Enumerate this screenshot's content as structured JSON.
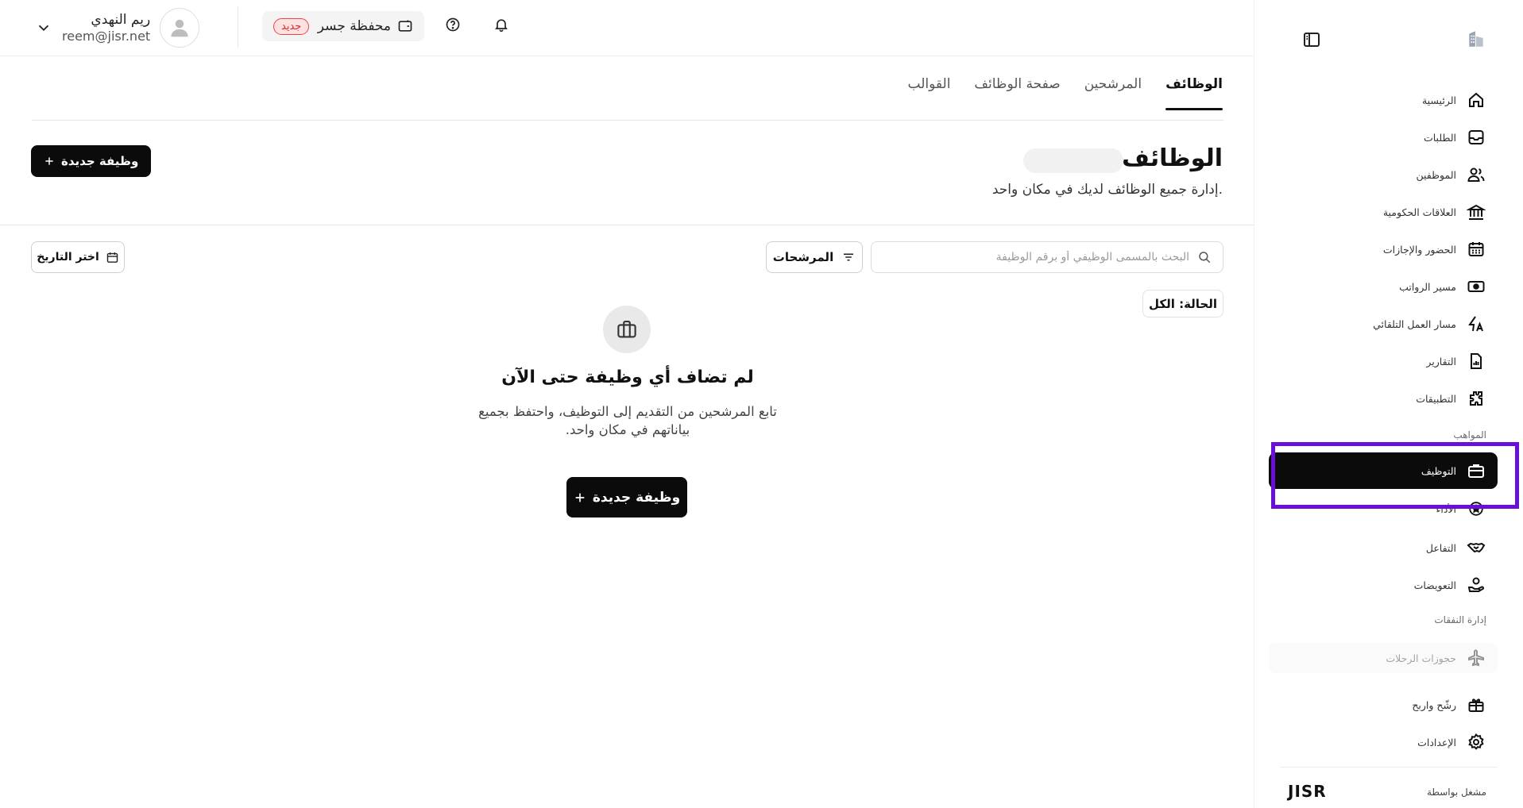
{
  "header": {
    "user_name": "ريم النهدي",
    "user_email": "reem@jisr.net",
    "wallet_label": "محفظة جسر",
    "wallet_badge": "جديد"
  },
  "tabs": [
    {
      "label": "الوظائف",
      "active": true
    },
    {
      "label": "المرشحين",
      "active": false
    },
    {
      "label": "صفحة الوظائف",
      "active": false
    },
    {
      "label": "القوالب",
      "active": false
    }
  ],
  "page": {
    "title": "الوظائف",
    "subtitle": "إدارة جميع الوظائف لديك في مكان واحد.",
    "new_job_label": "وظيفة جديدة"
  },
  "filters": {
    "search_placeholder": "البحث بالمسمى الوظيفي أو برقم الوظيفة",
    "filters_label": "المرشحات",
    "date_label": "اختر التاريخ",
    "status_chip": "الحالة: الكل"
  },
  "empty_state": {
    "title": "لم تضاف أي وظيفة حتى الآن",
    "description": "تابع المرشحين من التقديم إلى التوظيف، واحتفظ بجميع بياناتهم في مكان واحد.",
    "button_label": "وظيفة جديدة"
  },
  "sidebar": {
    "items": [
      {
        "label": "الرئيسية",
        "icon": "home-icon"
      },
      {
        "label": "الطلبات",
        "icon": "inbox-icon"
      },
      {
        "label": "الموظفين",
        "icon": "users-icon"
      },
      {
        "label": "العلاقات الحكومية",
        "icon": "bank-icon"
      },
      {
        "label": "الحضور والإجازات",
        "icon": "calendar-icon"
      },
      {
        "label": "مسير الرواتب",
        "icon": "cash-icon"
      },
      {
        "label": "مسار العمل التلقائي",
        "icon": "automation-icon"
      },
      {
        "label": "التقارير",
        "icon": "report-icon"
      },
      {
        "label": "التطبيقات",
        "icon": "puzzle-icon"
      }
    ],
    "talent_heading": "المواهب",
    "talent_items": [
      {
        "label": "التوظيف",
        "icon": "briefcase-icon",
        "active": true
      },
      {
        "label": "الأداء",
        "icon": "star-icon"
      },
      {
        "label": "التفاعل",
        "icon": "handshake-icon"
      },
      {
        "label": "التعويضات",
        "icon": "hand-coin-icon"
      }
    ],
    "expenses_heading": "إدارة النفقات",
    "expense_items": [
      {
        "label": "حجوزات الرحلات",
        "icon": "plane-icon",
        "disabled": true
      }
    ],
    "bottom_items": [
      {
        "label": "رشّح واربح",
        "icon": "gift-icon"
      },
      {
        "label": "الإعدادات",
        "icon": "settings-icon"
      }
    ],
    "powered_by": "مشغل بواسطة",
    "brand": "JISR"
  },
  "colors": {
    "primary": "#0b0b0c",
    "highlight": "#6a0fd6",
    "badge_red": "#dc2626"
  }
}
